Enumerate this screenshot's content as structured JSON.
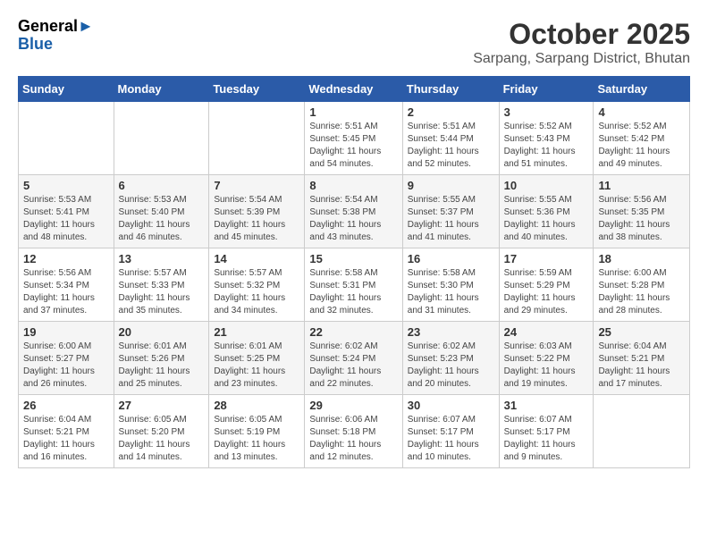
{
  "header": {
    "logo_general": "General",
    "logo_blue": "Blue",
    "title": "October 2025",
    "subtitle": "Sarpang, Sarpang District, Bhutan"
  },
  "weekdays": [
    "Sunday",
    "Monday",
    "Tuesday",
    "Wednesday",
    "Thursday",
    "Friday",
    "Saturday"
  ],
  "weeks": [
    [
      {
        "day": "",
        "sunrise": "",
        "sunset": "",
        "daylight": ""
      },
      {
        "day": "",
        "sunrise": "",
        "sunset": "",
        "daylight": ""
      },
      {
        "day": "",
        "sunrise": "",
        "sunset": "",
        "daylight": ""
      },
      {
        "day": "1",
        "sunrise": "5:51 AM",
        "sunset": "5:45 PM",
        "daylight": "11 hours and 54 minutes."
      },
      {
        "day": "2",
        "sunrise": "5:51 AM",
        "sunset": "5:44 PM",
        "daylight": "11 hours and 52 minutes."
      },
      {
        "day": "3",
        "sunrise": "5:52 AM",
        "sunset": "5:43 PM",
        "daylight": "11 hours and 51 minutes."
      },
      {
        "day": "4",
        "sunrise": "5:52 AM",
        "sunset": "5:42 PM",
        "daylight": "11 hours and 49 minutes."
      }
    ],
    [
      {
        "day": "5",
        "sunrise": "5:53 AM",
        "sunset": "5:41 PM",
        "daylight": "11 hours and 48 minutes."
      },
      {
        "day": "6",
        "sunrise": "5:53 AM",
        "sunset": "5:40 PM",
        "daylight": "11 hours and 46 minutes."
      },
      {
        "day": "7",
        "sunrise": "5:54 AM",
        "sunset": "5:39 PM",
        "daylight": "11 hours and 45 minutes."
      },
      {
        "day": "8",
        "sunrise": "5:54 AM",
        "sunset": "5:38 PM",
        "daylight": "11 hours and 43 minutes."
      },
      {
        "day": "9",
        "sunrise": "5:55 AM",
        "sunset": "5:37 PM",
        "daylight": "11 hours and 41 minutes."
      },
      {
        "day": "10",
        "sunrise": "5:55 AM",
        "sunset": "5:36 PM",
        "daylight": "11 hours and 40 minutes."
      },
      {
        "day": "11",
        "sunrise": "5:56 AM",
        "sunset": "5:35 PM",
        "daylight": "11 hours and 38 minutes."
      }
    ],
    [
      {
        "day": "12",
        "sunrise": "5:56 AM",
        "sunset": "5:34 PM",
        "daylight": "11 hours and 37 minutes."
      },
      {
        "day": "13",
        "sunrise": "5:57 AM",
        "sunset": "5:33 PM",
        "daylight": "11 hours and 35 minutes."
      },
      {
        "day": "14",
        "sunrise": "5:57 AM",
        "sunset": "5:32 PM",
        "daylight": "11 hours and 34 minutes."
      },
      {
        "day": "15",
        "sunrise": "5:58 AM",
        "sunset": "5:31 PM",
        "daylight": "11 hours and 32 minutes."
      },
      {
        "day": "16",
        "sunrise": "5:58 AM",
        "sunset": "5:30 PM",
        "daylight": "11 hours and 31 minutes."
      },
      {
        "day": "17",
        "sunrise": "5:59 AM",
        "sunset": "5:29 PM",
        "daylight": "11 hours and 29 minutes."
      },
      {
        "day": "18",
        "sunrise": "6:00 AM",
        "sunset": "5:28 PM",
        "daylight": "11 hours and 28 minutes."
      }
    ],
    [
      {
        "day": "19",
        "sunrise": "6:00 AM",
        "sunset": "5:27 PM",
        "daylight": "11 hours and 26 minutes."
      },
      {
        "day": "20",
        "sunrise": "6:01 AM",
        "sunset": "5:26 PM",
        "daylight": "11 hours and 25 minutes."
      },
      {
        "day": "21",
        "sunrise": "6:01 AM",
        "sunset": "5:25 PM",
        "daylight": "11 hours and 23 minutes."
      },
      {
        "day": "22",
        "sunrise": "6:02 AM",
        "sunset": "5:24 PM",
        "daylight": "11 hours and 22 minutes."
      },
      {
        "day": "23",
        "sunrise": "6:02 AM",
        "sunset": "5:23 PM",
        "daylight": "11 hours and 20 minutes."
      },
      {
        "day": "24",
        "sunrise": "6:03 AM",
        "sunset": "5:22 PM",
        "daylight": "11 hours and 19 minutes."
      },
      {
        "day": "25",
        "sunrise": "6:04 AM",
        "sunset": "5:21 PM",
        "daylight": "11 hours and 17 minutes."
      }
    ],
    [
      {
        "day": "26",
        "sunrise": "6:04 AM",
        "sunset": "5:21 PM",
        "daylight": "11 hours and 16 minutes."
      },
      {
        "day": "27",
        "sunrise": "6:05 AM",
        "sunset": "5:20 PM",
        "daylight": "11 hours and 14 minutes."
      },
      {
        "day": "28",
        "sunrise": "6:05 AM",
        "sunset": "5:19 PM",
        "daylight": "11 hours and 13 minutes."
      },
      {
        "day": "29",
        "sunrise": "6:06 AM",
        "sunset": "5:18 PM",
        "daylight": "11 hours and 12 minutes."
      },
      {
        "day": "30",
        "sunrise": "6:07 AM",
        "sunset": "5:17 PM",
        "daylight": "11 hours and 10 minutes."
      },
      {
        "day": "31",
        "sunrise": "6:07 AM",
        "sunset": "5:17 PM",
        "daylight": "11 hours and 9 minutes."
      },
      {
        "day": "",
        "sunrise": "",
        "sunset": "",
        "daylight": ""
      }
    ]
  ]
}
